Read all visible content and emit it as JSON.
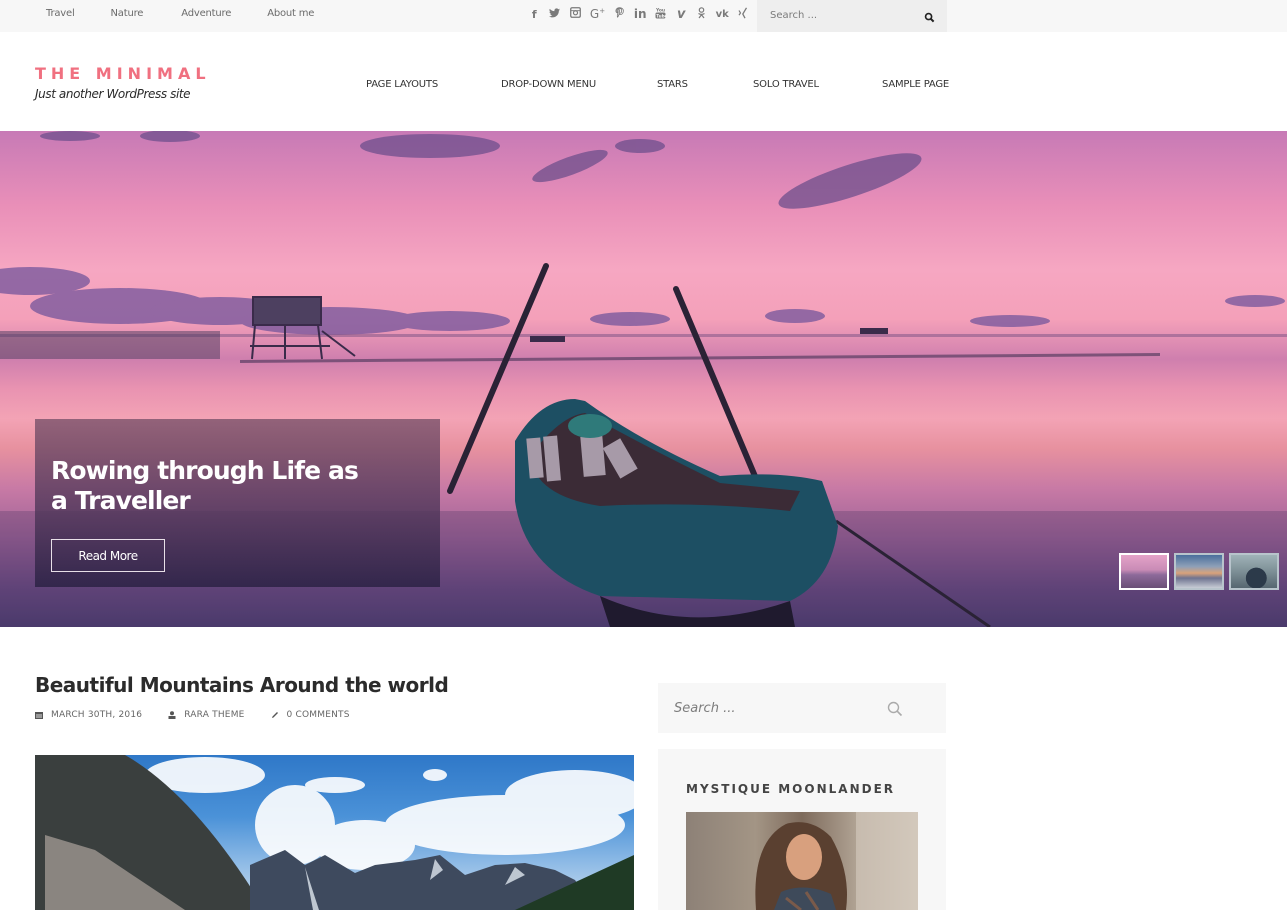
{
  "topbar": {
    "nav": [
      {
        "label": "Travel"
      },
      {
        "label": "Nature"
      },
      {
        "label": "Adventure"
      },
      {
        "label": "About me"
      }
    ],
    "social": [
      {
        "name": "facebook",
        "glyph": "f"
      },
      {
        "name": "twitter",
        "glyph": "🐦"
      },
      {
        "name": "instagram",
        "glyph": "◫"
      },
      {
        "name": "google-plus",
        "glyph": "G+"
      },
      {
        "name": "pinterest",
        "glyph": "℗"
      },
      {
        "name": "linkedin",
        "glyph": "in"
      },
      {
        "name": "youtube",
        "glyph": "▣"
      },
      {
        "name": "vimeo",
        "glyph": "v"
      },
      {
        "name": "odnoklassniki",
        "glyph": "ꝋ"
      },
      {
        "name": "vk",
        "glyph": "vk"
      },
      {
        "name": "xing",
        "glyph": "✗"
      }
    ],
    "search_placeholder": "Search ..."
  },
  "header": {
    "site_title": "THE MINIMAL",
    "tagline": "Just another WordPress site",
    "nav": [
      {
        "label": "PAGE LAYOUTS"
      },
      {
        "label": "DROP-DOWN MENU"
      },
      {
        "label": "STARS"
      },
      {
        "label": "SOLO TRAVEL"
      },
      {
        "label": "SAMPLE PAGE"
      }
    ]
  },
  "hero": {
    "title": "Rowing through Life as a Traveller",
    "button_label": "Read More",
    "slides": [
      {
        "name": "boat-sunset",
        "active": true
      },
      {
        "name": "beach-sunset",
        "active": false
      },
      {
        "name": "person-hood",
        "active": false
      }
    ]
  },
  "post": {
    "title": "Beautiful Mountains Around the world",
    "date": "MARCH 30TH, 2016",
    "author": "RARA THEME",
    "comments": "0 COMMENTS"
  },
  "sidebar": {
    "search_placeholder": "Search ...",
    "profile_widget_title": "MYSTIQUE MOONLANDER"
  },
  "colors": {
    "accent": "#f07080",
    "topbar_bg": "#f7f7f7",
    "widget_bg": "#f7f7f7"
  }
}
